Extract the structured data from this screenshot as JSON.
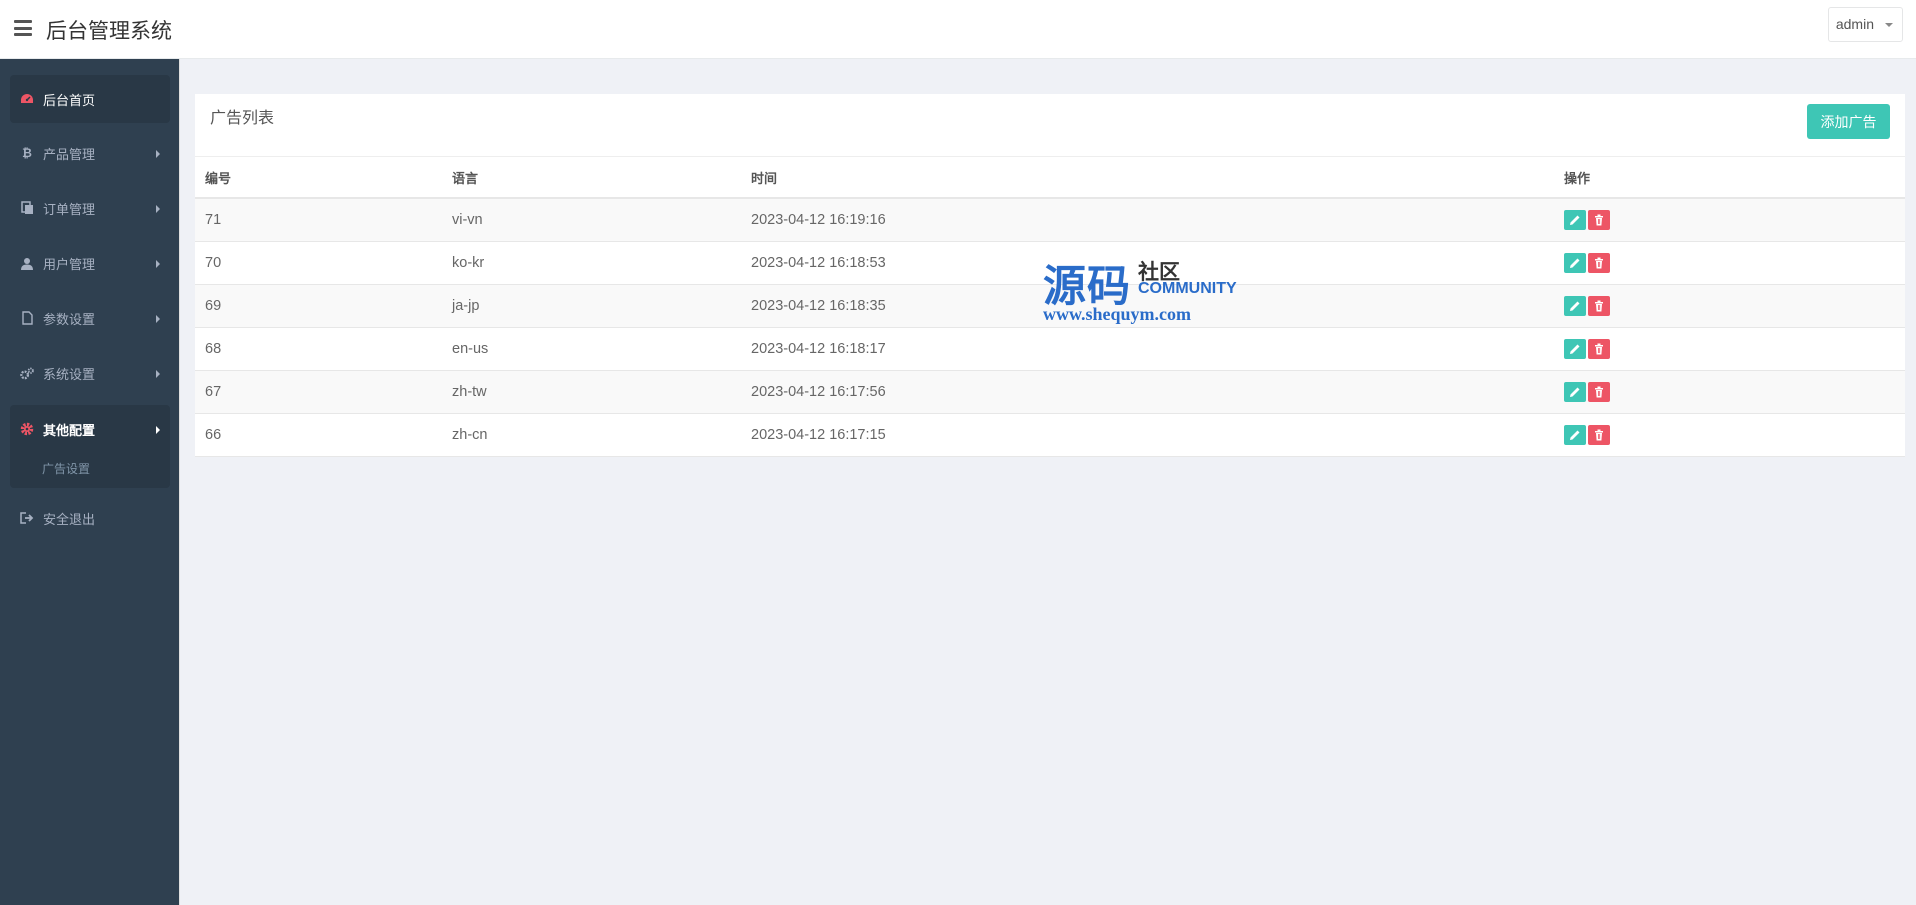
{
  "header": {
    "title": "后台管理系统",
    "user": "admin"
  },
  "sidebar": {
    "items": [
      {
        "label": "后台首页",
        "icon": "dashboard-icon"
      },
      {
        "label": "产品管理",
        "icon": "bitcoin-icon"
      },
      {
        "label": "订单管理",
        "icon": "files-icon"
      },
      {
        "label": "用户管理",
        "icon": "user-icon"
      },
      {
        "label": "参数设置",
        "icon": "file-icon"
      },
      {
        "label": "系统设置",
        "icon": "cogs-icon"
      },
      {
        "label": "其他配置",
        "icon": "gear-icon"
      },
      {
        "label": "安全退出",
        "icon": "sign-out-icon"
      }
    ],
    "submenu": {
      "label": "广告设置"
    }
  },
  "panel": {
    "title": "广告列表",
    "add_label": "添加广告"
  },
  "table": {
    "headers": [
      "编号",
      "语言",
      "时间",
      "操作"
    ],
    "rows": [
      {
        "id": "71",
        "lang": "vi-vn",
        "time": "2023-04-12 16:19:16"
      },
      {
        "id": "70",
        "lang": "ko-kr",
        "time": "2023-04-12 16:18:53"
      },
      {
        "id": "69",
        "lang": "ja-jp",
        "time": "2023-04-12 16:18:35"
      },
      {
        "id": "68",
        "lang": "en-us",
        "time": "2023-04-12 16:18:17"
      },
      {
        "id": "67",
        "lang": "zh-tw",
        "time": "2023-04-12 16:17:56"
      },
      {
        "id": "66",
        "lang": "zh-cn",
        "time": "2023-04-12 16:17:15"
      }
    ]
  },
  "watermark": {
    "big": "源码",
    "small": "社区",
    "community": "COMMUNITY",
    "url": "www.shequym.com"
  },
  "colors": {
    "sidebar_bg": "#2f4050",
    "accent": "#3ec6b5",
    "danger": "#ed5565",
    "active_icon": "#ed5565"
  }
}
